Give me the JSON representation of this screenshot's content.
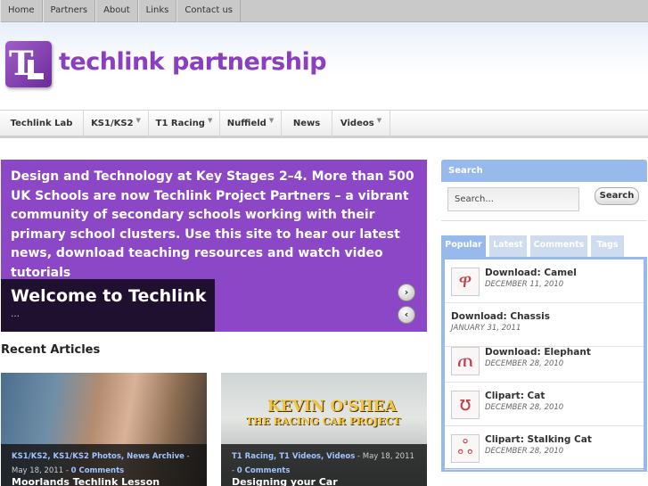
{
  "top_nav": [
    "Home",
    "Partners",
    "About",
    "Links",
    "Contact us"
  ],
  "brand": {
    "name": "techlink partnership",
    "logo_text": "TL"
  },
  "main_nav": [
    {
      "label": "Techlink Lab",
      "has_dropdown": false
    },
    {
      "label": "KS1/KS2",
      "has_dropdown": true
    },
    {
      "label": "T1 Racing",
      "has_dropdown": true
    },
    {
      "label": "Nuffield",
      "has_dropdown": true
    },
    {
      "label": "News",
      "has_dropdown": false
    },
    {
      "label": "Videos",
      "has_dropdown": true
    }
  ],
  "slider": {
    "text": "Design and Technology at Key Stages 2–4. More than 500 UK Schools are now Techlink Project Partners – a vibrant community of secondary schools working with their primary school clusters. Use this site to hear our latest news, download teaching resources and watch video tutorials",
    "caption_title": "Welcome to Techlink",
    "caption_desc": "…",
    "next_icon": "›",
    "prev_icon": "‹"
  },
  "recent": {
    "heading": "Recent Articles",
    "articles": [
      {
        "categories": "KS1/KS2, KS1/KS2 Photos, News Archive",
        "date": " - May 18, 2011 - ",
        "comments": "0 Comments",
        "title": "Moorlands Techlink Lesson"
      },
      {
        "categories": "T1 Racing, T1 Videos, Videos",
        "date": " - May 18, 2011 - ",
        "comments": "0 Comments",
        "title": "Designing your Car",
        "image_text_1": "KEVIN O'SHEA",
        "image_text_2": "THE RACING CAR PROJECT"
      }
    ]
  },
  "search": {
    "heading": "Search",
    "placeholder": "Search...",
    "button": "Search"
  },
  "tabs": [
    "Popular",
    "Latest",
    "Comments",
    "Tags"
  ],
  "popular": [
    {
      "title": "Download: Camel",
      "date": "DECEMBER 11, 2010",
      "icon": "camel-icon"
    },
    {
      "title": "Download: Chassis",
      "date": "JANUARY 31, 2011",
      "icon": ""
    },
    {
      "title": "Download: Elephant",
      "date": "DECEMBER 28, 2010",
      "icon": "elephant-icon"
    },
    {
      "title": "Clipart: Cat",
      "date": "DECEMBER 28, 2010",
      "icon": "cat-icon"
    },
    {
      "title": "Clipart: Stalking Cat",
      "date": "DECEMBER 28, 2010",
      "icon": "stalking-cat-icon"
    }
  ],
  "colors": {
    "accent_purple": "#8c47c6",
    "sidebar_blue": "#98b9ec",
    "brand_purple": "#8a3fc0"
  }
}
